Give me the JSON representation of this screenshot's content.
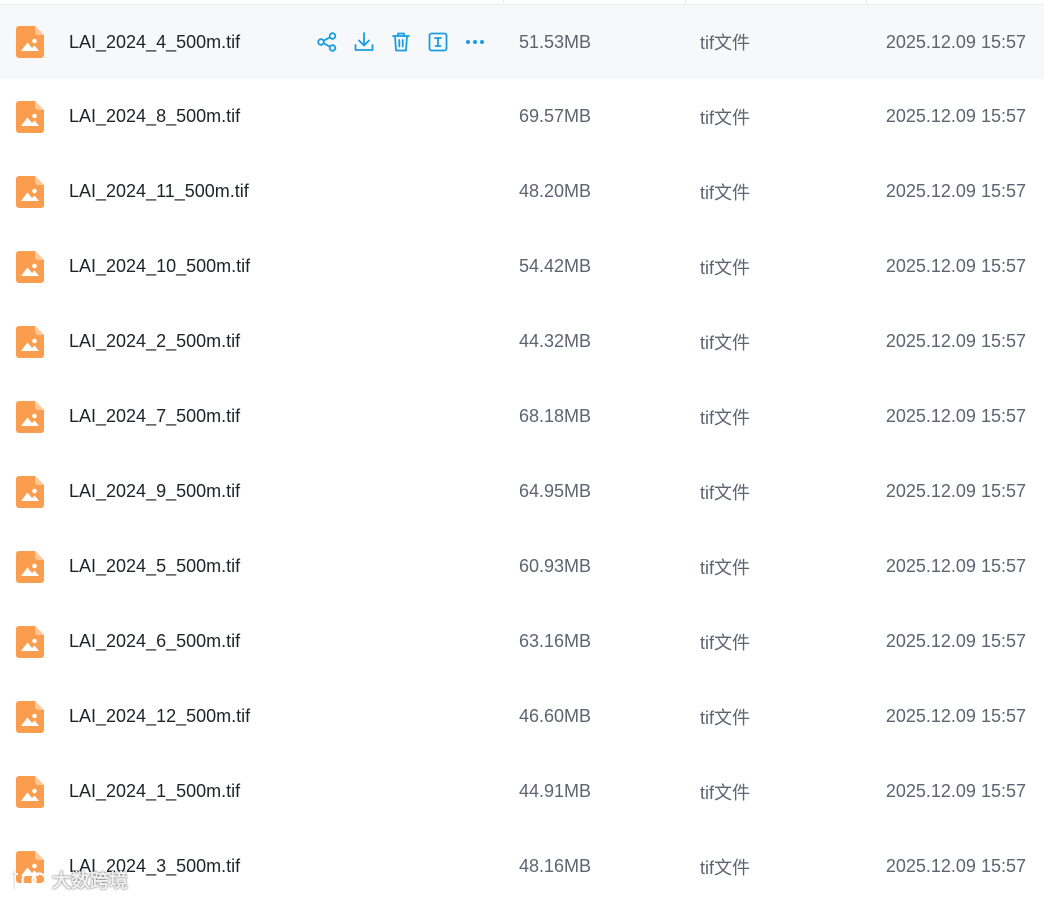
{
  "files": [
    {
      "name": "LAI_2024_4_500m.tif",
      "size": "51.53MB",
      "type": "tif文件",
      "date": "2025.12.09 15:57"
    },
    {
      "name": "LAI_2024_8_500m.tif",
      "size": "69.57MB",
      "type": "tif文件",
      "date": "2025.12.09 15:57"
    },
    {
      "name": "LAI_2024_11_500m.tif",
      "size": "48.20MB",
      "type": "tif文件",
      "date": "2025.12.09 15:57"
    },
    {
      "name": "LAI_2024_10_500m.tif",
      "size": "54.42MB",
      "type": "tif文件",
      "date": "2025.12.09 15:57"
    },
    {
      "name": "LAI_2024_2_500m.tif",
      "size": "44.32MB",
      "type": "tif文件",
      "date": "2025.12.09 15:57"
    },
    {
      "name": "LAI_2024_7_500m.tif",
      "size": "68.18MB",
      "type": "tif文件",
      "date": "2025.12.09 15:57"
    },
    {
      "name": "LAI_2024_9_500m.tif",
      "size": "64.95MB",
      "type": "tif文件",
      "date": "2025.12.09 15:57"
    },
    {
      "name": "LAI_2024_5_500m.tif",
      "size": "60.93MB",
      "type": "tif文件",
      "date": "2025.12.09 15:57"
    },
    {
      "name": "LAI_2024_6_500m.tif",
      "size": "63.16MB",
      "type": "tif文件",
      "date": "2025.12.09 15:57"
    },
    {
      "name": "LAI_2024_12_500m.tif",
      "size": "46.60MB",
      "type": "tif文件",
      "date": "2025.12.09 15:57"
    },
    {
      "name": "LAI_2024_1_500m.tif",
      "size": "44.91MB",
      "type": "tif文件",
      "date": "2025.12.09 15:57"
    },
    {
      "name": "LAI_2024_3_500m.tif",
      "size": "48.16MB",
      "type": "tif文件",
      "date": "2025.12.09 15:57"
    }
  ],
  "hovered_row_actions": [
    "share-icon",
    "download-icon",
    "delete-icon",
    "rename-icon",
    "more-icon"
  ],
  "file_icon": "image-file-icon",
  "watermark": {
    "text": "大数跨境"
  },
  "colors": {
    "file_icon": "#fb9d4f",
    "action_icon": "#1a9de0",
    "name_text": "#1f2329",
    "meta_text": "#5d6470",
    "hover_bg": "#f7f8fa"
  }
}
